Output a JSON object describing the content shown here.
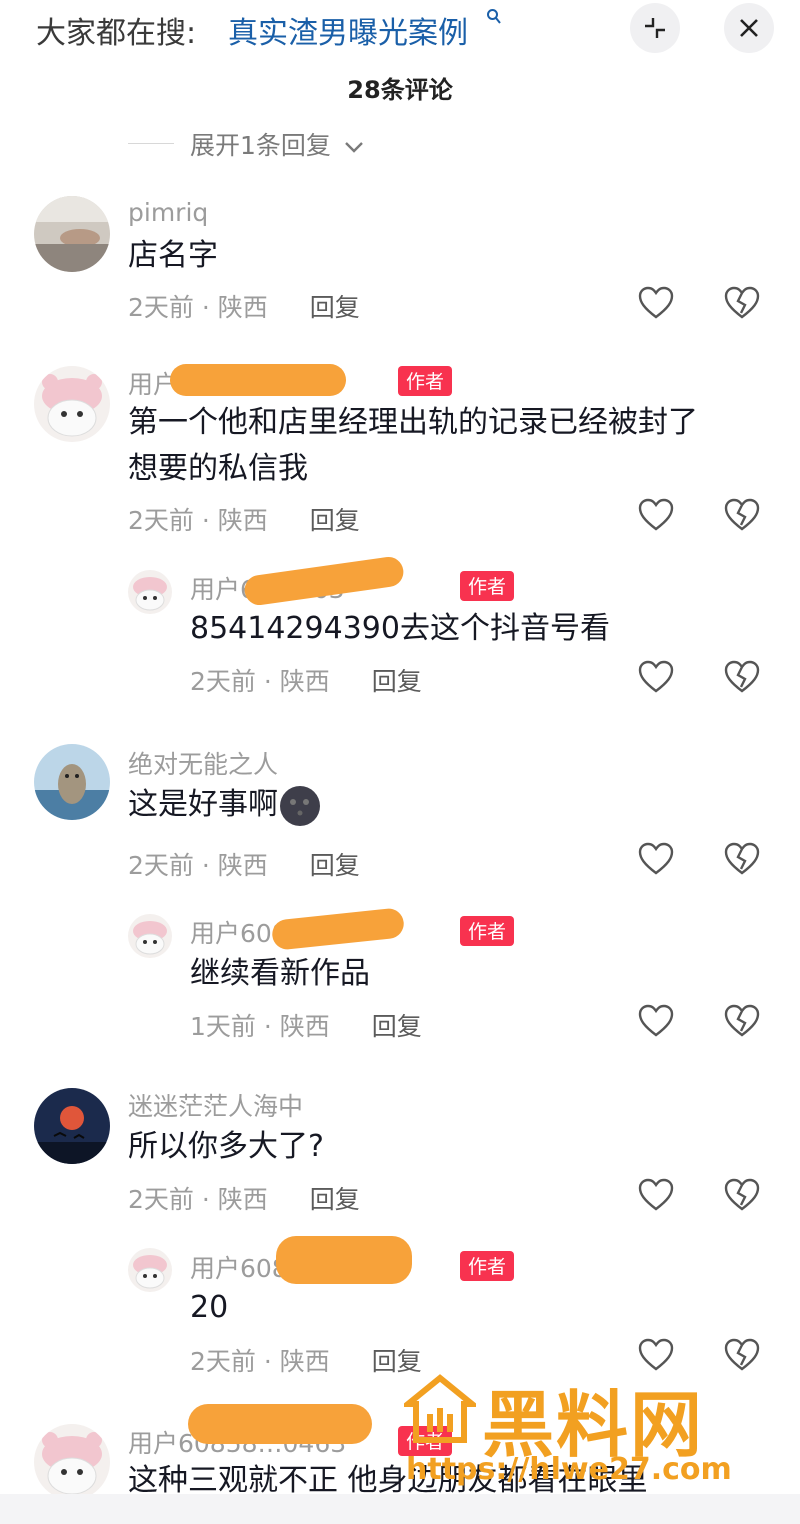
{
  "search": {
    "prefix": "大家都在搜:",
    "term": "真实渣男曝光案例"
  },
  "header": {
    "count": "28条评论"
  },
  "expand": {
    "label": "展开1条回复"
  },
  "labels": {
    "reply": "回复",
    "author": "作者"
  },
  "comments": [
    {
      "user": "pimriq",
      "text": "店名字",
      "time": "2天前",
      "loc": "陕西"
    },
    {
      "user": "用户60…463",
      "text1": "第一个他和店里经理出轨的记录已经被封了",
      "text2": "想要的私信我",
      "time": "2天前",
      "loc": "陕西"
    },
    {
      "user": "用户60…463",
      "text": "85414294390去这个抖音号看",
      "time": "2天前",
      "loc": "陕西"
    },
    {
      "user": "绝对无能之人",
      "text": "这是好事啊",
      "time": "2天前",
      "loc": "陕西"
    },
    {
      "user": "用户608…463",
      "text": "继续看新作品",
      "time": "1天前",
      "loc": "陕西"
    },
    {
      "user": "迷迷茫茫人海中",
      "text": "所以你多大了?",
      "time": "2天前",
      "loc": "陕西"
    },
    {
      "user": "用户608…0463",
      "text": "20",
      "time": "2天前",
      "loc": "陕西"
    },
    {
      "user": "用户60858…0463",
      "text": "这种三观就不正 他身边朋友都看在眼里"
    }
  ],
  "watermark": {
    "name": "黑料网",
    "url": "https://hlwe27.com"
  }
}
